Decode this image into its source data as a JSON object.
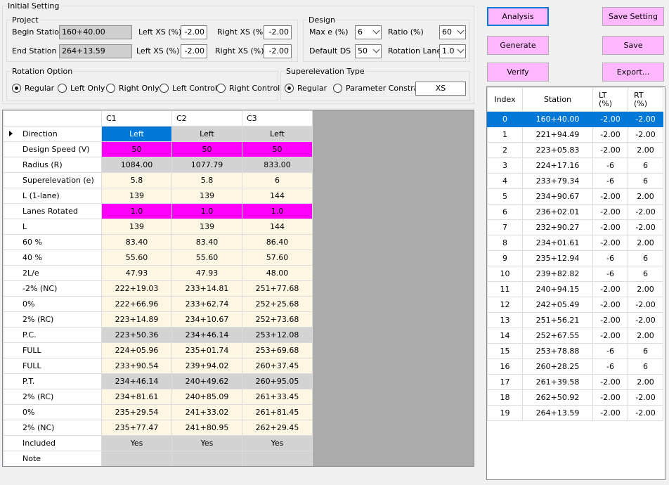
{
  "initial_setting": {
    "title": "Initial Setting",
    "project": {
      "title": "Project",
      "begin_station_label": "Begin Station",
      "begin_station": "160+40.00",
      "end_station_label": "End Station",
      "end_station": "264+13.59",
      "left_xs_label": "Left XS (%)",
      "right_xs_label": "Right XS (%)",
      "begin_left_xs": "-2.00",
      "begin_right_xs": "-2.00",
      "end_left_xs": "-2.00",
      "end_right_xs": "-2.00"
    },
    "design": {
      "title": "Design",
      "max_e_label": "Max e (%)",
      "max_e": "6",
      "ratio_label": "Ratio (%)",
      "ratio": "60",
      "default_ds_label": "Default DS",
      "default_ds": "50",
      "rotation_lane_label": "Rotation Lane",
      "rotation_lane": "1.0"
    },
    "rotation_option": {
      "title": "Rotation Option",
      "options": [
        "Regular",
        "Left Only",
        "Right Only",
        "Left Control",
        "Right Control"
      ],
      "selected": "Regular"
    },
    "superelevation_type": {
      "title": "Superelevation Type",
      "options": [
        "Regular",
        "Parameter Constrain"
      ],
      "selected": "Regular",
      "xs_value": "XS"
    }
  },
  "buttons": {
    "analysis": "Analysis",
    "save_setting": "Save Setting",
    "generate": "Generate",
    "save": "Save",
    "verify": "Verify",
    "export": "Export..."
  },
  "colors": {
    "button_bg": "#ffb8ff",
    "magenta": "#ff00ff",
    "selection": "#0078d7",
    "cell_bg": "#fdf6e3",
    "gray_cell": "#d3d3d3"
  },
  "curve_grid": {
    "columns": [
      "C1",
      "C2",
      "C3"
    ],
    "rows": [
      {
        "label": "Direction",
        "values": [
          "Left",
          "Left",
          "Left"
        ],
        "style": [
          "sel",
          "g",
          "g"
        ],
        "current": true
      },
      {
        "label": "Design Speed (V)",
        "values": [
          "50",
          "50",
          "50"
        ],
        "style": [
          "m",
          "m",
          "m"
        ]
      },
      {
        "label": "Radius (R)",
        "values": [
          "1084.00",
          "1077.79",
          "833.00"
        ],
        "style": [
          "g",
          "g",
          "g"
        ]
      },
      {
        "label": "Superelevation (e)",
        "values": [
          "5.8",
          "5.8",
          "6"
        ]
      },
      {
        "label": "L (1-lane)",
        "values": [
          "139",
          "139",
          "144"
        ]
      },
      {
        "label": "Lanes Rotated",
        "values": [
          "1.0",
          "1.0",
          "1.0"
        ],
        "style": [
          "m",
          "m",
          "m"
        ]
      },
      {
        "label": "L",
        "values": [
          "139",
          "139",
          "144"
        ]
      },
      {
        "label": "60 %",
        "values": [
          "83.40",
          "83.40",
          "86.40"
        ]
      },
      {
        "label": "40 %",
        "values": [
          "55.60",
          "55.60",
          "57.60"
        ]
      },
      {
        "label": "2L/e",
        "values": [
          "47.93",
          "47.93",
          "48.00"
        ]
      },
      {
        "label": "-2% (NC)",
        "values": [
          "222+19.03",
          "233+14.81",
          "251+77.68"
        ]
      },
      {
        "label": " 0%",
        "values": [
          "222+66.96",
          "233+62.74",
          "252+25.68"
        ]
      },
      {
        "label": "2% (RC)",
        "values": [
          "223+14.89",
          "234+10.67",
          "252+73.68"
        ]
      },
      {
        "label": "P.C.",
        "values": [
          "223+50.36",
          "234+46.14",
          "253+12.08"
        ],
        "style": [
          "g",
          "g",
          "g"
        ]
      },
      {
        "label": "FULL",
        "values": [
          "224+05.96",
          "235+01.74",
          "253+69.68"
        ]
      },
      {
        "label": "FULL",
        "values": [
          "233+90.54",
          "239+94.02",
          "260+37.45"
        ]
      },
      {
        "label": "P.T.",
        "values": [
          "234+46.14",
          "240+49.62",
          "260+95.05"
        ],
        "style": [
          "g",
          "g",
          "g"
        ]
      },
      {
        "label": "2% (RC)",
        "values": [
          "234+81.61",
          "240+85.09",
          "261+33.45"
        ]
      },
      {
        "label": "0%",
        "values": [
          "235+29.54",
          "241+33.02",
          "261+81.45"
        ]
      },
      {
        "label": "2% (NC)",
        "values": [
          "235+77.47",
          "241+80.95",
          "262+29.45"
        ]
      },
      {
        "label": "Included",
        "values": [
          "Yes",
          "Yes",
          "Yes"
        ],
        "style": [
          "g",
          "g",
          "g"
        ]
      },
      {
        "label": "Note",
        "values": [
          "",
          "",
          ""
        ],
        "style": [
          "g",
          "g",
          "g"
        ]
      }
    ]
  },
  "station_list": {
    "headers": {
      "index": "Index",
      "station": "Station",
      "lt": "LT",
      "lt_unit": "(%)",
      "rt": "RT",
      "rt_unit": "(%)"
    },
    "rows": [
      {
        "index": "0",
        "station": "160+40.00",
        "lt": "-2.00",
        "rt": "-2.00"
      },
      {
        "index": "1",
        "station": "221+94.49",
        "lt": "-2.00",
        "rt": "-2.00"
      },
      {
        "index": "2",
        "station": "223+05.83",
        "lt": "-2.00",
        "rt": "2.00"
      },
      {
        "index": "3",
        "station": "224+17.16",
        "lt": "-6",
        "rt": "6"
      },
      {
        "index": "4",
        "station": "233+79.34",
        "lt": "-6",
        "rt": "6"
      },
      {
        "index": "5",
        "station": "234+90.67",
        "lt": "-2.00",
        "rt": "2.00"
      },
      {
        "index": "6",
        "station": "236+02.01",
        "lt": "-2.00",
        "rt": "-2.00"
      },
      {
        "index": "7",
        "station": "232+90.27",
        "lt": "-2.00",
        "rt": "-2.00"
      },
      {
        "index": "8",
        "station": "234+01.61",
        "lt": "-2.00",
        "rt": "2.00"
      },
      {
        "index": "9",
        "station": "235+12.94",
        "lt": "-6",
        "rt": "6"
      },
      {
        "index": "10",
        "station": "239+82.82",
        "lt": "-6",
        "rt": "6"
      },
      {
        "index": "11",
        "station": "240+94.15",
        "lt": "-2.00",
        "rt": "2.00"
      },
      {
        "index": "12",
        "station": "242+05.49",
        "lt": "-2.00",
        "rt": "-2.00"
      },
      {
        "index": "13",
        "station": "251+56.21",
        "lt": "-2.00",
        "rt": "-2.00"
      },
      {
        "index": "14",
        "station": "252+67.55",
        "lt": "-2.00",
        "rt": "2.00"
      },
      {
        "index": "15",
        "station": "253+78.88",
        "lt": "-6",
        "rt": "6"
      },
      {
        "index": "16",
        "station": "260+28.25",
        "lt": "-6",
        "rt": "6"
      },
      {
        "index": "17",
        "station": "261+39.58",
        "lt": "-2.00",
        "rt": "2.00"
      },
      {
        "index": "18",
        "station": "262+50.92",
        "lt": "-2.00",
        "rt": "-2.00"
      },
      {
        "index": "19",
        "station": "264+13.59",
        "lt": "-2.00",
        "rt": "-2.00"
      }
    ]
  }
}
